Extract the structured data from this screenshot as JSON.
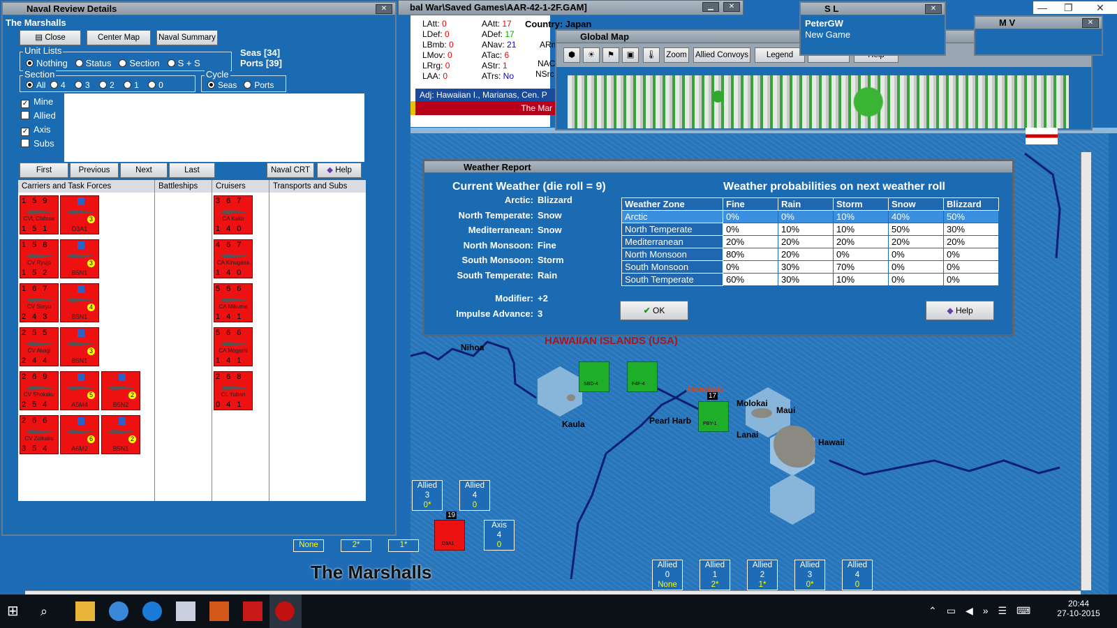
{
  "naval": {
    "title": "Naval Review Details",
    "sea_name": "The Marshalls",
    "buttons": {
      "close": "Close",
      "center_map": "Center Map",
      "naval_summary": "Naval Summary"
    },
    "seas_count": "Seas [34]",
    "ports_count": "Ports [39]",
    "unit_lists": {
      "caption": "Unit Lists",
      "options": [
        "Nothing",
        "Status",
        "Section",
        "S + S"
      ],
      "selected": "Nothing"
    },
    "section": {
      "caption": "Section",
      "options": [
        "All",
        "4",
        "3",
        "2",
        "1",
        "0"
      ],
      "selected": "All"
    },
    "cycle": {
      "caption": "Cycle",
      "options": [
        "Seas",
        "Ports"
      ],
      "selected": "Seas"
    },
    "filters": [
      {
        "label": "Mine",
        "checked": true
      },
      {
        "label": "Allied",
        "checked": false
      },
      {
        "label": "Axis",
        "checked": true
      },
      {
        "label": "Subs",
        "checked": false
      }
    ],
    "nav": {
      "first": "First",
      "previous": "Previous",
      "next": "Next",
      "last": "Last",
      "crt": "Naval CRT",
      "help": "Help"
    },
    "columns": [
      "Carriers and Task Forces",
      "Battleships",
      "Cruisers",
      "Transports and Subs"
    ],
    "carriers": [
      {
        "name": "CVL Chitose",
        "a": "1",
        "b": "5",
        "c": "9",
        "d": "1",
        "e": "5",
        "f": "1"
      },
      {
        "name": "CV Ryujo",
        "a": "1",
        "b": "5",
        "c": "8",
        "d": "1",
        "e": "5",
        "f": "2"
      },
      {
        "name": "CV Soryu",
        "a": "1",
        "b": "6",
        "c": "7",
        "d": "2",
        "e": "4",
        "f": "3"
      },
      {
        "name": "CV Akagi",
        "a": "2",
        "b": "5",
        "c": "5",
        "d": "2",
        "e": "4",
        "f": "4"
      },
      {
        "name": "CV Shokaku",
        "a": "2",
        "b": "6",
        "c": "9",
        "d": "2",
        "e": "5",
        "f": "4"
      },
      {
        "name": "CV Zuikaku",
        "a": "2",
        "b": "6",
        "c": "6",
        "d": "3",
        "e": "5",
        "f": "4"
      }
    ],
    "air": [
      {
        "name": "D3A1",
        "v": "3"
      },
      {
        "name": "B5N1",
        "v": "3"
      },
      {
        "name": "B5N1",
        "v": "4"
      },
      {
        "name": "B5N1",
        "v": "3"
      },
      {
        "name": "A5M4",
        "v": "5"
      },
      {
        "name": "A6M2",
        "v": "6"
      },
      {
        "name": "B5N2",
        "v": "2"
      },
      {
        "name": "B5N1",
        "v": "2"
      }
    ],
    "cruisers": [
      {
        "name": "CA Kako",
        "a": "3",
        "b": "6",
        "c": "7",
        "d": "1",
        "e": "4",
        "f": "0"
      },
      {
        "name": "CA Kinugasa",
        "a": "4",
        "b": "6",
        "c": "7",
        "d": "1",
        "e": "4",
        "f": "0"
      },
      {
        "name": "CA Mikuma",
        "a": "5",
        "b": "6",
        "c": "6",
        "d": "1",
        "e": "4",
        "f": "1"
      },
      {
        "name": "CA Mogami",
        "a": "5",
        "b": "6",
        "c": "6",
        "d": "1",
        "e": "4",
        "f": "1"
      },
      {
        "name": "CL Yubari",
        "a": "2",
        "b": "6",
        "c": "8",
        "d": "0",
        "e": "4",
        "f": "1"
      }
    ]
  },
  "savegame_title": "bal War\\Saved Games\\AAR-42-1-2F.GAM]",
  "info": {
    "left": [
      [
        "LAtt:",
        "0"
      ],
      [
        "LDef:",
        "0"
      ],
      [
        "LBmb:",
        "0"
      ],
      [
        "LMov:",
        "0"
      ],
      [
        "LRrg:",
        "0"
      ],
      [
        "LAA:",
        "0"
      ]
    ],
    "mid": [
      [
        "AAtt:",
        "17"
      ],
      [
        "ADef:",
        "17"
      ],
      [
        "ANav:",
        "21"
      ],
      [
        "ATac:",
        "6"
      ],
      [
        "AStr:",
        "1"
      ],
      [
        "ATrs:",
        "No"
      ]
    ],
    "country": "Country: Japan",
    "adj": "Adj: Hawaiian I., Marianas, Cen. P",
    "banner": "The Mar",
    "frag1": "ARn",
    "frag2": "NAC",
    "frag3": "NSrc"
  },
  "global_map": {
    "title": "Global Map",
    "zoom": "Zoom",
    "allied_convoys": "Allied Convoys",
    "legend": "Legend",
    "help": "Help"
  },
  "player_sl": {
    "title": "S L",
    "name": "PeterGW",
    "sub": "New Game"
  },
  "player_mv": {
    "title": "M V"
  },
  "weather": {
    "title": "Weather Report",
    "current": "Current Weather (die roll = 9)",
    "next": "Weather probabilities on next weather roll",
    "current_list": [
      [
        "Arctic:",
        "Blizzard"
      ],
      [
        "North Temperate:",
        "Snow"
      ],
      [
        "Mediterranean:",
        "Snow"
      ],
      [
        "North Monsoon:",
        "Fine"
      ],
      [
        "South Monsoon:",
        "Storm"
      ],
      [
        "South Temperate:",
        "Rain"
      ]
    ],
    "modifier": [
      "Modifier:",
      "+2"
    ],
    "impulse": [
      "Impulse Advance:",
      "3"
    ],
    "table_headers": [
      "Weather Zone",
      "Fine",
      "Rain",
      "Storm",
      "Snow",
      "Blizzard"
    ],
    "rows": [
      [
        "Arctic",
        "0%",
        "0%",
        "10%",
        "40%",
        "50%"
      ],
      [
        "North Temperate",
        "0%",
        "10%",
        "10%",
        "50%",
        "30%"
      ],
      [
        "Mediterranean",
        "20%",
        "20%",
        "20%",
        "20%",
        "20%"
      ],
      [
        "North Monsoon",
        "80%",
        "20%",
        "0%",
        "0%",
        "0%"
      ],
      [
        "South Monsoon",
        "0%",
        "30%",
        "70%",
        "0%",
        "0%"
      ],
      [
        "South Temperate",
        "60%",
        "30%",
        "10%",
        "0%",
        "0%"
      ]
    ],
    "selected_row": "Arctic",
    "ok": "OK",
    "help": "Help"
  },
  "map_labels": {
    "hawaiian": "HAWAIIAN ISLANDS (USA)",
    "nihoa": "Nihoa",
    "kaula": "Kaula",
    "pearl": "Pearl Harb",
    "honolulu": "Honolulu",
    "molokai": "Molokai",
    "maui": "Maui",
    "lanai": "Lanai",
    "hawaii": "Hawaii",
    "marshalls": "The Marshalls",
    "stack_count": "19",
    "pby_count": "17",
    "unit_ssd": "SBD-4",
    "unit_f4f": "F4F-4",
    "unit_pby": "PBY-1",
    "unit_d3a": "D3A1"
  },
  "sections": [
    {
      "side": "Allied",
      "num": "3",
      "val": "0*"
    },
    {
      "side": "Allied",
      "num": "4",
      "val": "0"
    },
    {
      "side": "Axis",
      "num": "4",
      "val": "0"
    }
  ],
  "bottom_left": [
    "None",
    "2*",
    "1*"
  ],
  "bottom_sections": [
    {
      "side": "Allied",
      "num": "0",
      "val": "None"
    },
    {
      "side": "Allied",
      "num": "1",
      "val": "2*"
    },
    {
      "side": "Allied",
      "num": "2",
      "val": "1*"
    },
    {
      "side": "Allied",
      "num": "3",
      "val": "0*"
    },
    {
      "side": "Allied",
      "num": "4",
      "val": "0"
    }
  ],
  "clock": {
    "time": "20:44",
    "date": "27-10-2015"
  }
}
